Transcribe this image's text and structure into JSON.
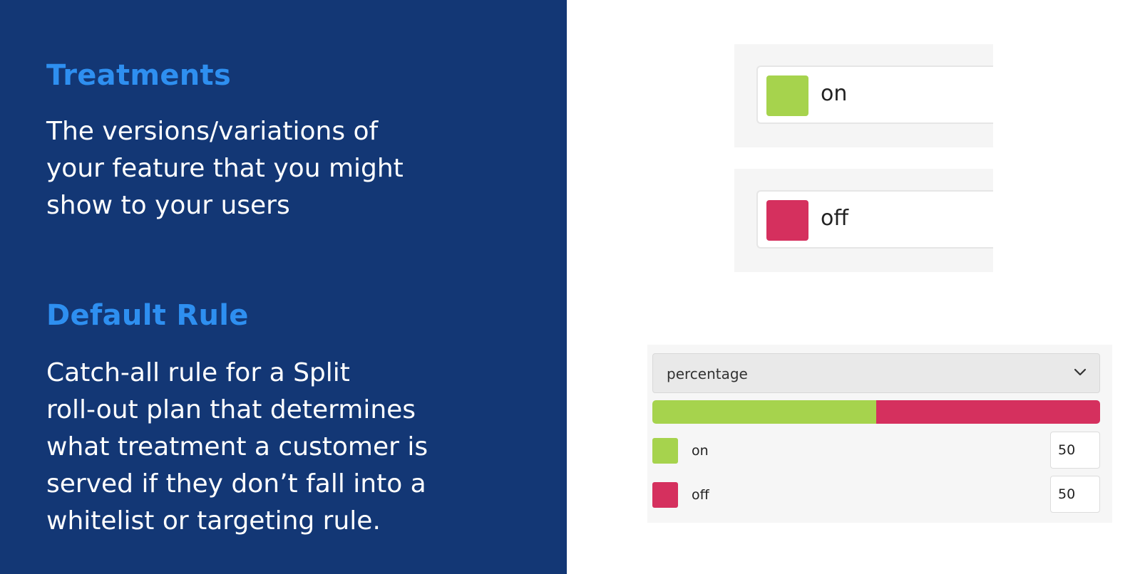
{
  "colors": {
    "left_panel_background": "#133775",
    "heading": "#2e8ff0",
    "body_text": "#ffffff",
    "on": "#a6d34d",
    "off": "#d5305e"
  },
  "left_panel": {
    "treatments": {
      "heading": "Treatments",
      "body": "The versions/variations of\nyour feature that you might\nshow to your users"
    },
    "default_rule": {
      "heading": "Default Rule",
      "body": "Catch-all rule for a Split\nroll-out plan that determines\nwhat treatment a customer is\nserved if they don’t fall into a\nwhitelist or targeting rule."
    }
  },
  "treatments": [
    {
      "label": "on",
      "color": "#a6d34d",
      "icon": "color-swatch"
    },
    {
      "label": "off",
      "color": "#d5305e",
      "icon": "color-swatch"
    }
  ],
  "default_rule": {
    "select_value": "percentage",
    "select_icon": "chevron-down",
    "allocations": [
      {
        "label": "on",
        "percent": 50,
        "value": "50",
        "color": "#a6d34d"
      },
      {
        "label": "off",
        "percent": 50,
        "value": "50",
        "color": "#d5305e"
      }
    ]
  }
}
